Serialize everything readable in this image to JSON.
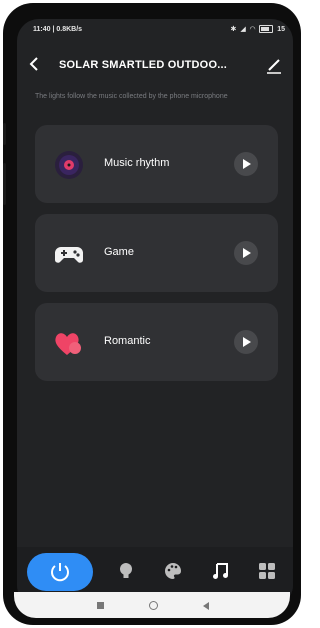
{
  "status_bar": {
    "left": "11:40 | 0.8KB/s",
    "battery": "15"
  },
  "header": {
    "title": "SOLAR SMARTLED OUTDOO..."
  },
  "subtitle": "The lights follow the music collected by the phone microphone",
  "modes": [
    {
      "label": "Music rhythm",
      "icon": "vinyl-record-icon"
    },
    {
      "label": "Game",
      "icon": "gamepad-icon"
    },
    {
      "label": "Romantic",
      "icon": "hearts-icon"
    }
  ],
  "bottom_nav": {
    "items": [
      "power-icon",
      "bulb-icon",
      "palette-icon",
      "music-note-icon",
      "grid-icon"
    ],
    "active_color": "#2f8df5"
  },
  "colors": {
    "background": "#222325",
    "card": "#303134",
    "accent": "#2f8df5"
  }
}
